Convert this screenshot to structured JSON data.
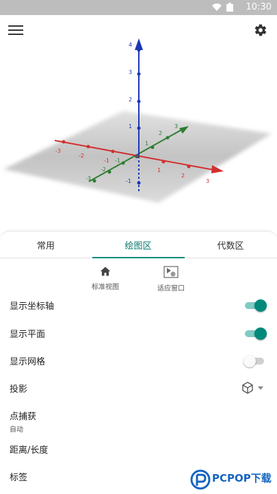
{
  "status_bar": {
    "time": "10:30"
  },
  "toolbar": {
    "menu_icon": "hamburger-menu-icon",
    "settings_icon": "gear-icon"
  },
  "graph": {
    "z_ticks": [
      "4",
      "3",
      "2",
      "1",
      "-1"
    ],
    "x_ticks_left": [
      "-3",
      "-2",
      "-1"
    ],
    "x_ticks_right": [
      "1",
      "2",
      "3"
    ],
    "y_ticks_top": [
      "1",
      "2",
      "3"
    ],
    "y_ticks_bottom": [
      "-1",
      "-2",
      "-3"
    ],
    "colors": {
      "x_axis": "#d32f2f",
      "y_axis": "#2e7d32",
      "z_axis": "#1a37b8",
      "plane": "#cccccc"
    }
  },
  "tabs": [
    {
      "label": "常用"
    },
    {
      "label": "绘图区"
    },
    {
      "label": "代数区"
    }
  ],
  "active_tab": "绘图区",
  "quick_actions": [
    {
      "label": "标准视图",
      "icon": "home-icon"
    },
    {
      "label": "适应窗口",
      "icon": "fit-window-icon"
    }
  ],
  "settings": {
    "show_axes": {
      "label": "显示坐标轴",
      "on": true
    },
    "show_plane": {
      "label": "显示平面",
      "on": true
    },
    "show_grid": {
      "label": "显示网格",
      "on": false
    },
    "projection": {
      "label": "投影",
      "icon": "cube-icon"
    },
    "point_capture": {
      "label": "点捕获",
      "value": "自动"
    },
    "distance": {
      "label": "距离/长度"
    },
    "labels": {
      "label": "标签"
    }
  },
  "watermark": {
    "text": "PCPOP下载"
  },
  "accent_color": "#00897b"
}
